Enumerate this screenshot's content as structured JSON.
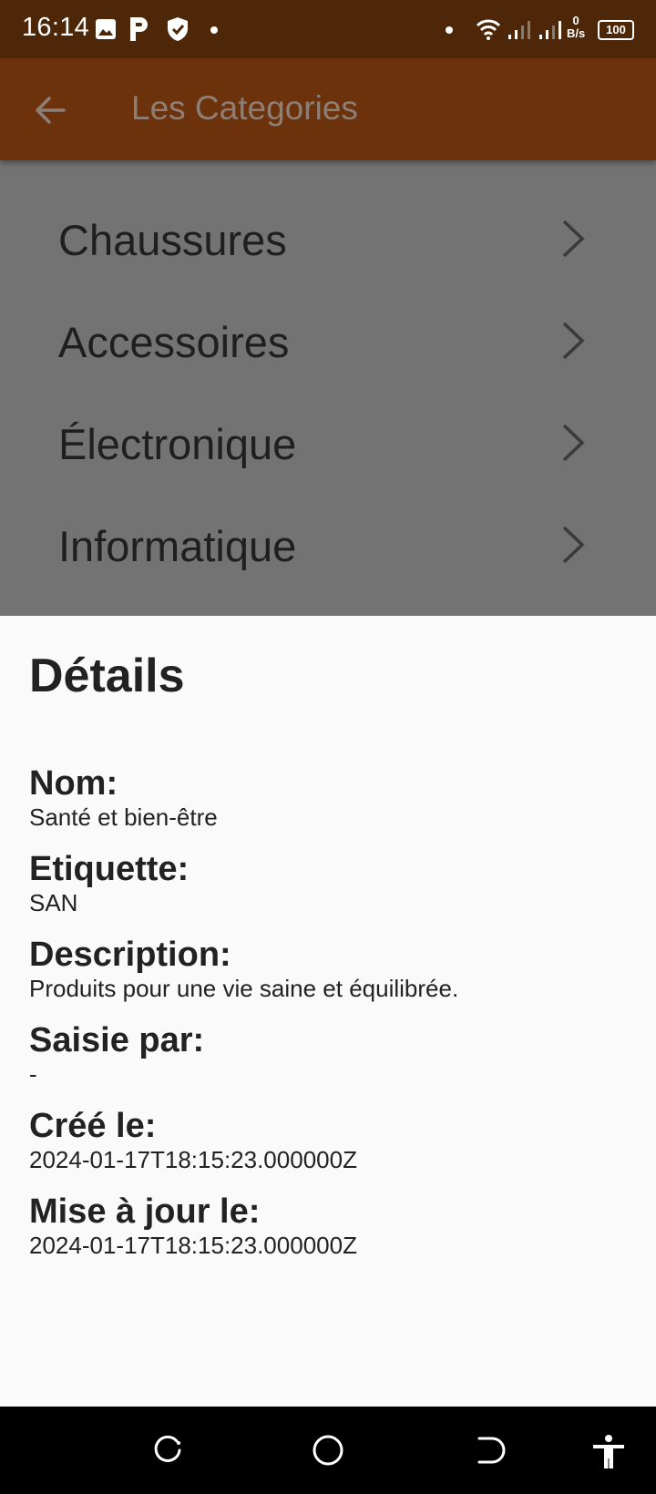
{
  "status_bar": {
    "time": "16:14",
    "net_speed_value": "0",
    "net_speed_unit": "B/s",
    "battery": "100",
    "icons": [
      "image-icon",
      "parking-icon",
      "shield-icon",
      "dot-icon",
      "wifi-icon",
      "signal-icon",
      "signal-icon",
      "battery-icon"
    ]
  },
  "app_bar": {
    "title": "Les Categories",
    "back_icon": "arrow-left-icon",
    "background": "#6b320c"
  },
  "categories": [
    {
      "label": "Chaussures"
    },
    {
      "label": "Accessoires"
    },
    {
      "label": "Électronique"
    },
    {
      "label": "Informatique"
    }
  ],
  "details": {
    "heading": "Détails",
    "fields": [
      {
        "label": "Nom:",
        "value": "Santé et bien-être"
      },
      {
        "label": "Etiquette:",
        "value": "SAN"
      },
      {
        "label": "Description:",
        "value": "Produits pour une vie saine et équilibrée."
      },
      {
        "label": "Saisie par:",
        "value": "-"
      },
      {
        "label": "Créé le:",
        "value": "2024-01-17T18:15:23.000000Z"
      },
      {
        "label": "Mise à jour le:",
        "value": "2024-01-17T18:15:23.000000Z"
      }
    ]
  },
  "nav_bar": {
    "icons": [
      "recents-icon",
      "home-icon",
      "back-icon",
      "accessibility-icon"
    ]
  }
}
